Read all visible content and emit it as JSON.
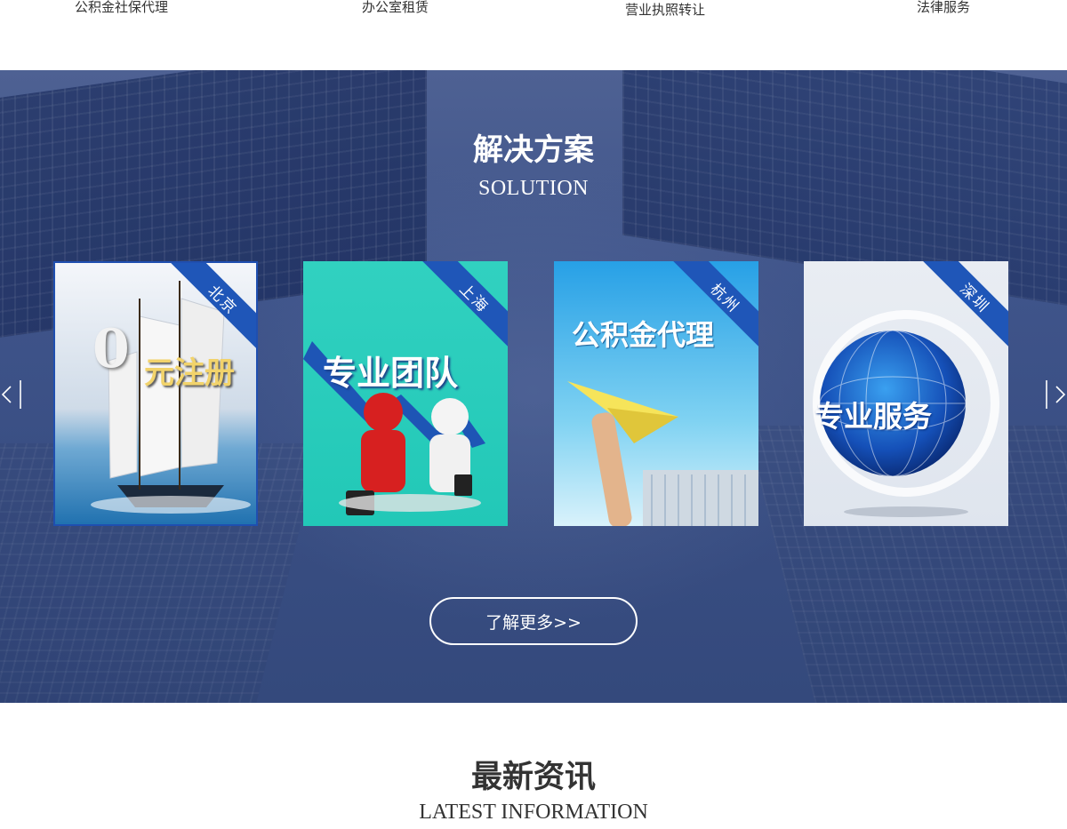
{
  "top_services": [
    {
      "label": "公积金社保代理"
    },
    {
      "label": "办公室租赁"
    },
    {
      "label": "营业执照转让"
    },
    {
      "label": "法律服务"
    }
  ],
  "solution": {
    "title_cn": "解决方案",
    "title_en": "SOLUTION",
    "prev_icon": "chevron-left-icon",
    "next_icon": "chevron-right-icon",
    "cards": [
      {
        "city": "北京",
        "caption_big": "0",
        "caption": "元注册",
        "active": true
      },
      {
        "city": "上海",
        "caption": "专业团队",
        "active": false
      },
      {
        "city": "杭州",
        "caption": "公积金代理",
        "active": false
      },
      {
        "city": "深圳",
        "caption": "专业服务",
        "active": false
      }
    ],
    "more_button": "了解更多>>"
  },
  "news": {
    "title_cn": "最新资讯",
    "title_en": "LATEST INFORMATION"
  },
  "colors": {
    "band": "#3f548a",
    "ribbon": "#1f56b8",
    "active_border": "#1f4fb0"
  }
}
